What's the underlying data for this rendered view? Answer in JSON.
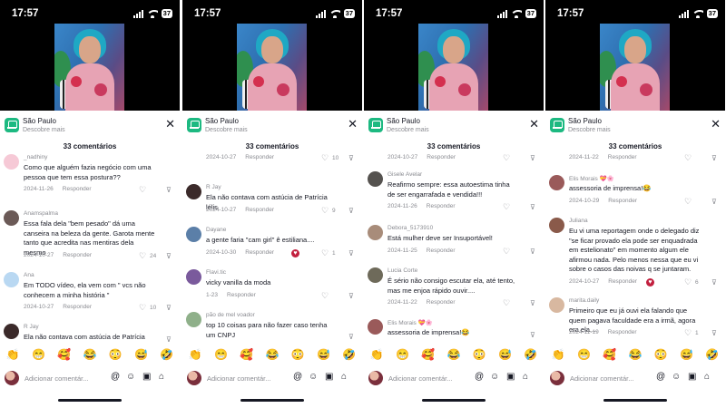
{
  "status": {
    "time": "17:57",
    "battery": "37"
  },
  "location": {
    "title": "São Paulo",
    "subtitle": "Descobre mais"
  },
  "comments_count": "33 comentários",
  "reply_label": "Responder",
  "input_placeholder": "Adicionar comentár...",
  "emojis": [
    "👏",
    "😁",
    "🥰",
    "😂",
    "😳",
    "😅",
    "🤣"
  ],
  "colors": {
    "accent": "#1db981",
    "text": "#161823",
    "muted": "#8a8b91",
    "creator_badge": "#c2203f"
  },
  "icons": [
    "close-icon",
    "heart-icon",
    "dislike-icon",
    "at-icon",
    "smiley-icon",
    "image-icon",
    "gift-icon"
  ],
  "panels": [
    {
      "comments": [
        {
          "author": "_nadhiny",
          "text": "Como que alguém fazia negócio com uma pessoa que tem essa postura??",
          "date": "2024-11-26",
          "likes": "",
          "avatar_color": "#f6c9d6"
        },
        {
          "author": "Anamspalma",
          "text": "Essa fala dela \"bem pesado\" dá uma canseira na beleza da gente. Garota mente tanto que acredita nas mentiras dela mesmo",
          "date": "2024-10-27",
          "likes": "24",
          "avatar_color": "#6b5a57"
        },
        {
          "author": "Ana",
          "text": "Em TODO vídeo, ela vem com \" vcs não conhecem a minha história \"",
          "date": "2024-10-27",
          "likes": "10",
          "avatar_color": "#b9d8f2"
        },
        {
          "author": "R Jay",
          "text": "Ela não contava com astúcia de Patrícia lélis",
          "date": "",
          "likes": "",
          "avatar_color": "#3b2a2a"
        }
      ]
    },
    {
      "comments": [
        {
          "author": "",
          "text": "",
          "date": "2024-10-27",
          "likes": "10",
          "avatar_color": ""
        },
        {
          "author": "R Jay",
          "text": "Ela não contava com astúcia de Patrícia lélis",
          "date": "2024-10-27",
          "likes": "9",
          "avatar_color": "#3b2a2a"
        },
        {
          "author": "Dayane",
          "text": "a gente faria \"cam girl\" ê estiliana....",
          "date": "2024-10-30",
          "likes": "1",
          "avatar_color": "#5b7fa8"
        },
        {
          "author": "Flavi.tic",
          "text": "vicky vanilla da moda",
          "date": "1-23",
          "likes": "",
          "avatar_color": "#7a5a9c"
        },
        {
          "author": "pão de mel voador",
          "text": "top 10 coisas para não fazer caso tenha um CNPJ",
          "date": "",
          "likes": "",
          "avatar_color": "#8fb08a"
        }
      ]
    },
    {
      "comments": [
        {
          "author": "",
          "text": "",
          "date": "2024-10-27",
          "likes": "",
          "avatar_color": ""
        },
        {
          "author": "Gisele Avelar",
          "text": "Reafirmo sempre: essa autoestima tinha de ser engarrafada e vendida!!!",
          "date": "2024-11-26",
          "likes": "",
          "avatar_color": "#55524f"
        },
        {
          "author": "Debora_5173910",
          "text": "Está mulher deve ser Insuportável!",
          "date": "2024-11-25",
          "likes": "",
          "avatar_color": "#a88c7a"
        },
        {
          "author": "Lucia Corte",
          "text": "É sério não consigo escutar ela, até tento, mas me enjoa rápido ouvir....",
          "date": "2024-11-22",
          "likes": "",
          "avatar_color": "#6e6a5a"
        },
        {
          "author": "Elis Morais 💝🌸",
          "text": "assessoria de imprensa!😂",
          "date": "",
          "likes": "",
          "avatar_color": "#9a5a5a"
        }
      ]
    },
    {
      "comments": [
        {
          "author": "",
          "text": "",
          "date": "2024-11-22",
          "likes": "",
          "avatar_color": ""
        },
        {
          "author": "Elis Morais 💝🌸",
          "text": "assessoria de imprensa!😂",
          "date": "2024-10-29",
          "likes": "",
          "avatar_color": "#9a5a5a"
        },
        {
          "author": "Juliana",
          "text": "Eu vi uma reportagem onde o delegado diz \"se ficar provado ela pode ser enquadrada em estelionato\" em momento algum ele afirmou nada. Pelo menos nessa que eu vi sobre o casos das noivas q se juntaram.",
          "date": "2024-10-27",
          "likes": "6",
          "avatar_color": "#8a5a4a"
        },
        {
          "author": "marita.daily",
          "text": "Primeiro que eu já ouvi ela falando que quem pagava faculdade era a irmã, agora era ela....",
          "date": "2024-11-19",
          "likes": "1",
          "avatar_color": "#d8b8a0"
        }
      ]
    }
  ]
}
